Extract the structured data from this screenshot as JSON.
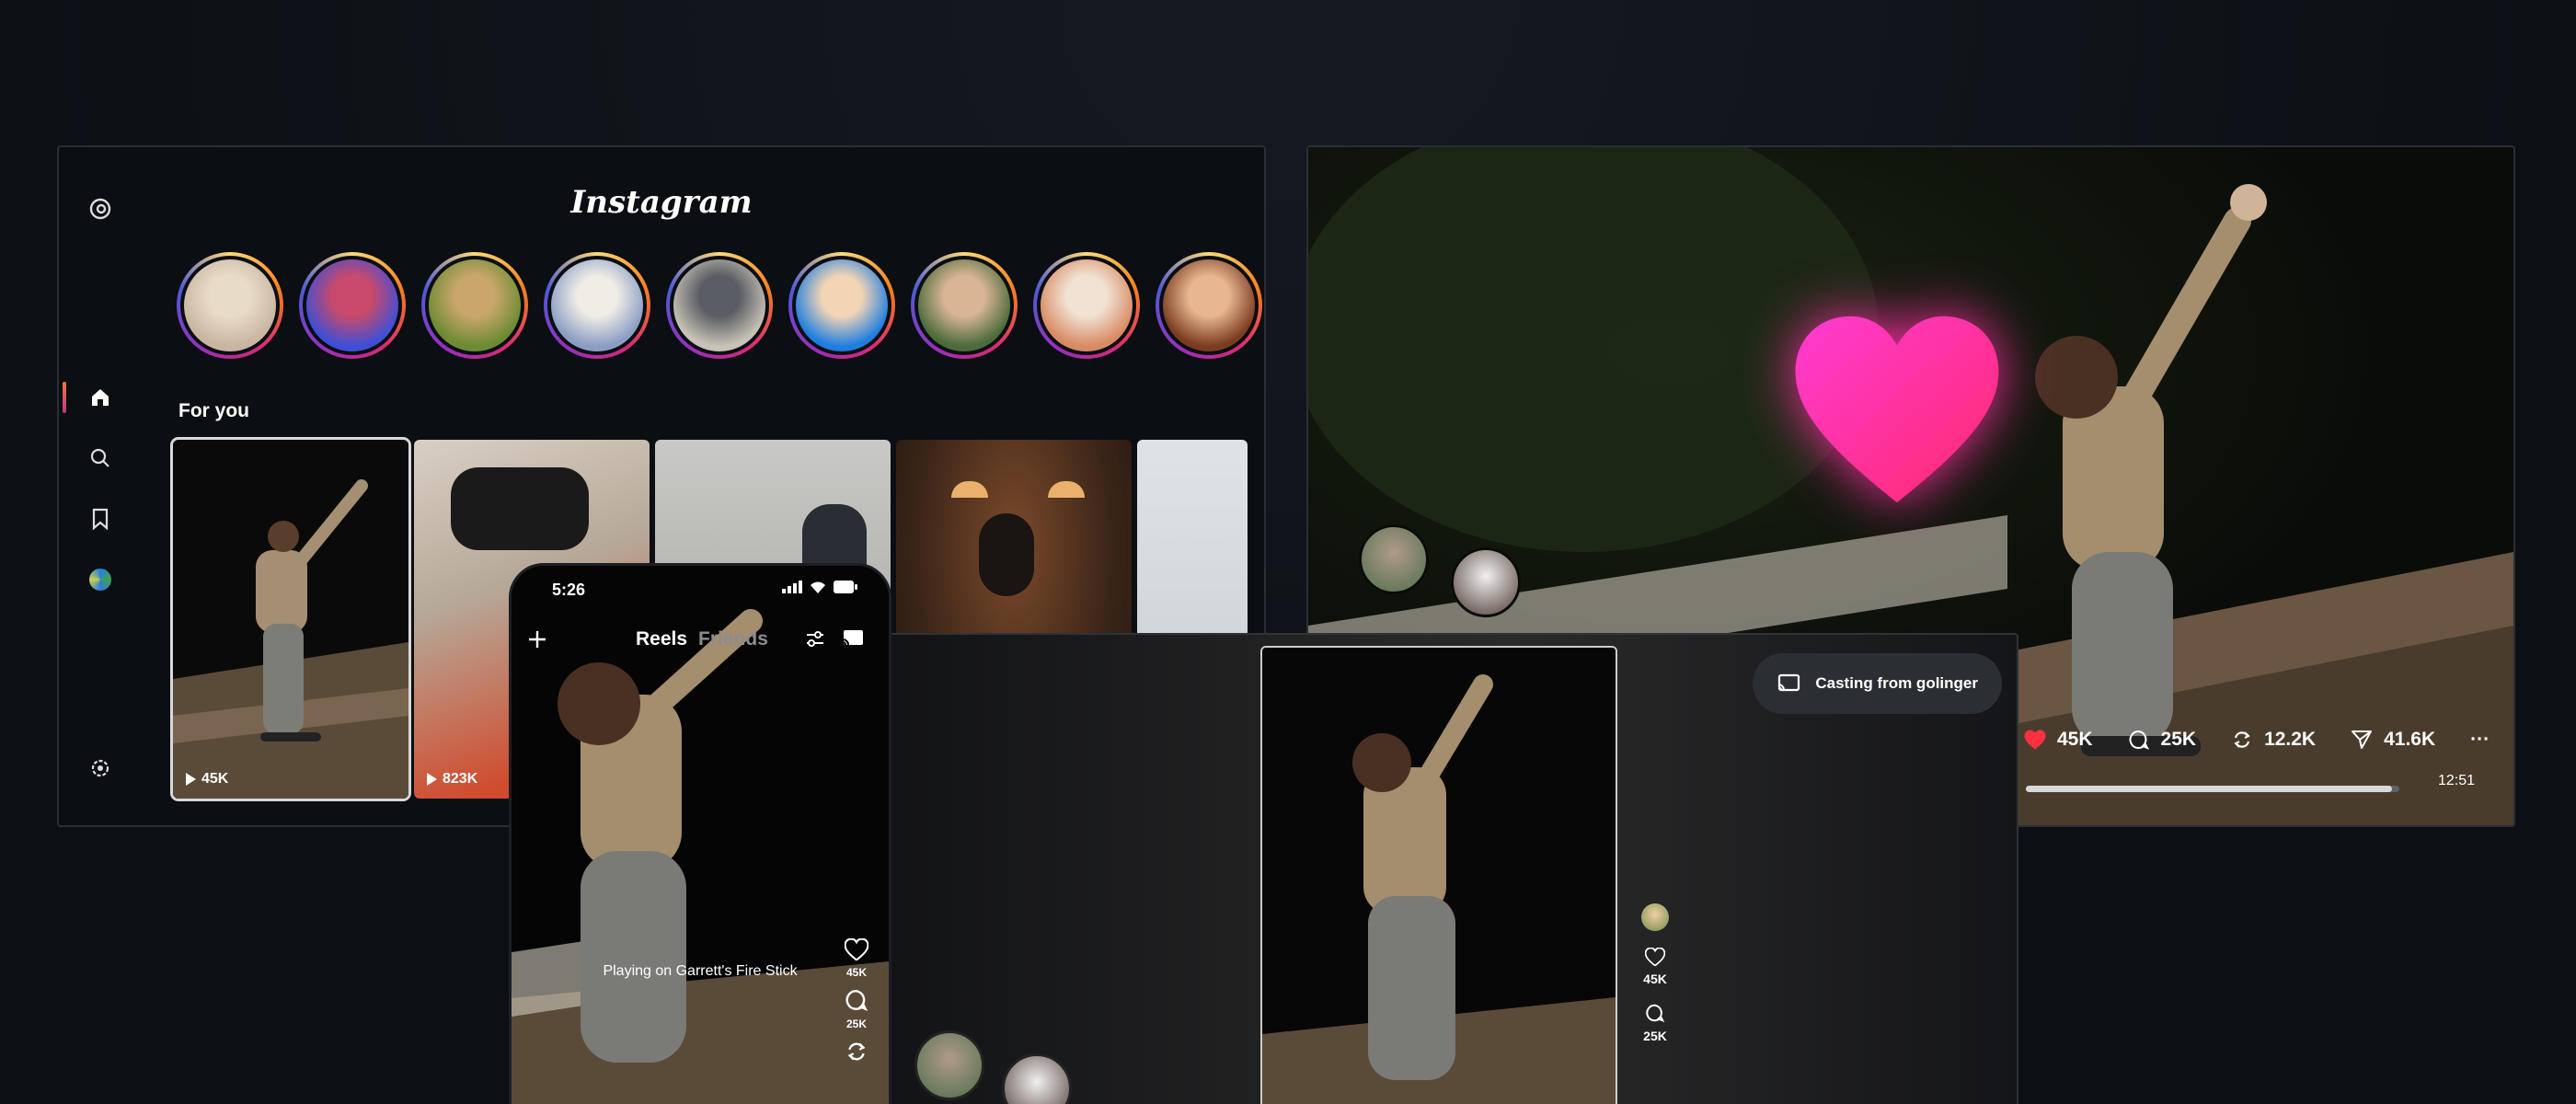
{
  "tv_home": {
    "brand": "Instagram",
    "section_title": "For you",
    "rail": [
      "threads-icon",
      "home-icon",
      "search-icon",
      "bookmark-icon",
      "profile-avatar",
      "settings-icon"
    ],
    "stories": [
      {
        "colors": [
          "#c9b5a0",
          "#e8dcc8"
        ]
      },
      {
        "colors": [
          "#3e4fd6",
          "#c94a6a"
        ]
      },
      {
        "colors": [
          "#6c8b32",
          "#c9a66b"
        ]
      },
      {
        "colors": [
          "#8b9dc3",
          "#f0ece6"
        ]
      },
      {
        "colors": [
          "#c8c3b7",
          "#5a5d64"
        ]
      },
      {
        "colors": [
          "#1e7ee0",
          "#f3d4b5"
        ]
      },
      {
        "colors": [
          "#4b6b3a",
          "#d9b595"
        ]
      },
      {
        "colors": [
          "#d88a63",
          "#f1e2d3"
        ]
      },
      {
        "colors": [
          "#7a3b20",
          "#e8b690"
        ]
      }
    ],
    "tiles": [
      {
        "views": "45K"
      },
      {
        "views": "823K"
      },
      {
        "views": ""
      },
      {
        "views": ""
      },
      {
        "views": ""
      }
    ]
  },
  "tv_player": {
    "stats": {
      "likes": "45K",
      "comments": "25K",
      "reposts": "12.2K",
      "shares": "41.6K",
      "more": "···"
    },
    "progress_time": "12:51",
    "progress_fraction": 0.98
  },
  "phone": {
    "time": "5:26",
    "tab_reels": "Reels",
    "tab_friends": "Friends",
    "casting_label": "Playing on Garrett's Fire Stick",
    "likes": "45K",
    "comments": "25K"
  },
  "tv_cast": {
    "pill_label": "Casting from golinger",
    "likes": "45K",
    "comments": "25K"
  },
  "colors": {
    "heart": "#ff2fa4",
    "story_ring_start": "#feda75",
    "story_ring_end": "#962fbf"
  }
}
